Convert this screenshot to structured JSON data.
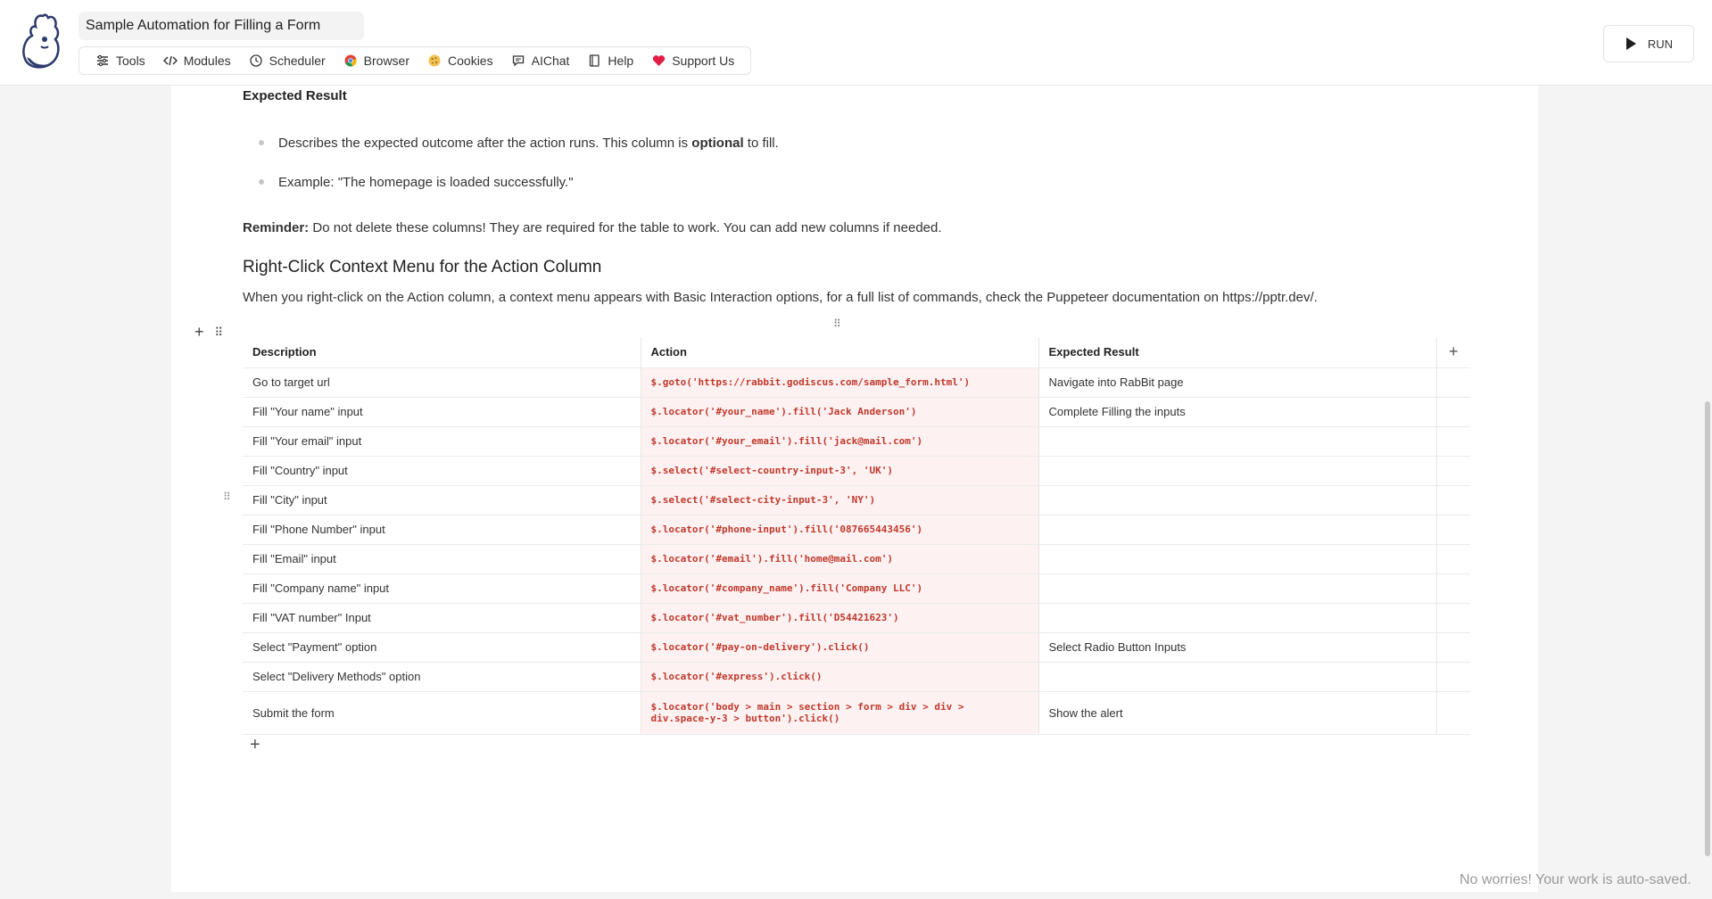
{
  "header": {
    "title": "Sample Automation for Filling a Form",
    "toolbar": [
      {
        "label": "Tools",
        "icon": "sliders-icon"
      },
      {
        "label": "Modules",
        "icon": "code-icon"
      },
      {
        "label": "Scheduler",
        "icon": "clock-icon"
      },
      {
        "label": "Browser",
        "icon": "chrome-icon"
      },
      {
        "label": "Cookies",
        "icon": "cookie-icon"
      },
      {
        "label": "AIChat",
        "icon": "chat-icon"
      },
      {
        "label": "Help",
        "icon": "book-icon"
      },
      {
        "label": "Support Us",
        "icon": "heart-icon"
      }
    ],
    "run_label": "RUN"
  },
  "doc": {
    "expected_heading": "Expected Result",
    "bullet1_pre": "Describes the expected outcome after the action runs. This column is ",
    "bullet1_bold": "optional",
    "bullet1_post": " to fill.",
    "bullet2": "Example: \"The homepage is loaded successfully.\"",
    "reminder_bold": "Reminder:",
    "reminder_text": " Do not delete these columns! They are required for the table to work. You can add new columns if needed.",
    "context_heading": "Right-Click Context Menu for the Action Column",
    "context_para": "When you right-click on the Action column, a context menu appears with Basic Interaction options, for a full list of commands, check the Puppeteer documentation on https://pptr.dev/."
  },
  "table": {
    "headers": {
      "description": "Description",
      "action": "Action",
      "expected": "Expected Result"
    },
    "rows": [
      {
        "description": "Go to target url",
        "action": "$.goto('https://rabbit.godiscus.com/sample_form.html')",
        "expected": "Navigate into RabBit page"
      },
      {
        "description": "Fill \"Your name\" input",
        "action": "$.locator('#your_name').fill('Jack Anderson')",
        "expected": "Complete Filling the inputs"
      },
      {
        "description": "Fill \"Your email\" input",
        "action": "$.locator('#your_email').fill('jack@mail.com')",
        "expected": ""
      },
      {
        "description": "Fill \"Country\" input",
        "action": "$.select('#select-country-input-3', 'UK')",
        "expected": ""
      },
      {
        "description": "Fill \"City\" input",
        "action": "$.select('#select-city-input-3', 'NY')",
        "expected": ""
      },
      {
        "description": "Fill \"Phone Number\" input",
        "action": "$.locator('#phone-input').fill('087665443456')",
        "expected": ""
      },
      {
        "description": "Fill \"Email\" input",
        "action": "$.locator('#email').fill('home@mail.com')",
        "expected": ""
      },
      {
        "description": "Fill \"Company name\" input",
        "action": "$.locator('#company_name').fill('Company LLC')",
        "expected": ""
      },
      {
        "description": "Fill \"VAT number\" Input",
        "action": "$.locator('#vat_number').fill('D54421623')",
        "expected": ""
      },
      {
        "description": "Select \"Payment\" option",
        "action": "$.locator('#pay-on-delivery').click()",
        "expected": "Select Radio Button Inputs"
      },
      {
        "description": "Select \"Delivery Methods\" option",
        "action": "$.locator('#express').click()",
        "expected": ""
      },
      {
        "description": "Submit the form",
        "action": "$.locator('body > main > section > form > div > div > div.space-y-3 > button').click()",
        "expected": "Show the alert"
      }
    ]
  },
  "footer": {
    "autosave": "No worries! Your work is auto-saved."
  },
  "colors": {
    "accent_red": "#c0392b",
    "action_bg": "#fdf1f2",
    "heart": "#e11d48"
  }
}
